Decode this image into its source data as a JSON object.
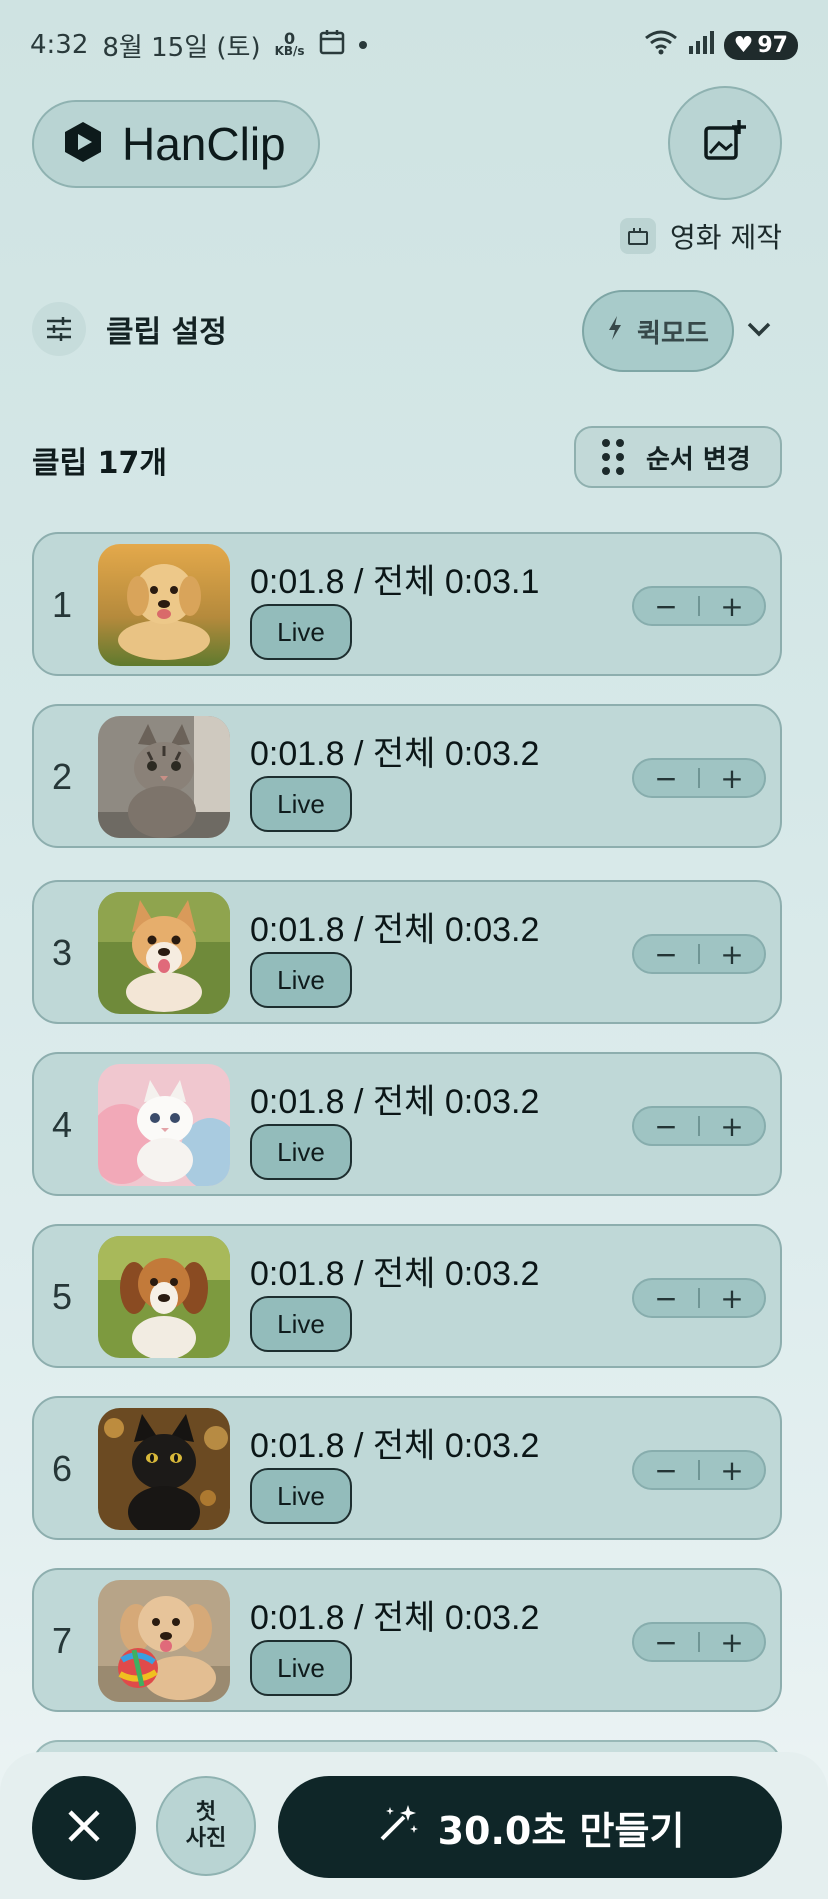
{
  "status_bar": {
    "time": "4:32",
    "date": "8월 15일 (토)",
    "net_speed_value": "0",
    "net_speed_unit": "KB/s",
    "battery": "97"
  },
  "header": {
    "app_name": "HanClip",
    "movie_label": "영화 제작"
  },
  "settings": {
    "clip_settings_label": "클립 설정",
    "quick_mode_label": "퀵모드"
  },
  "list_header": {
    "clip_count": "클립 17개",
    "reorder_label": "순서 변경"
  },
  "clips": [
    {
      "index": "1",
      "time": "0:01.8 / 전체 0:03.1",
      "badge": "Live"
    },
    {
      "index": "2",
      "time": "0:01.8 / 전체 0:03.2",
      "badge": "Live"
    },
    {
      "index": "3",
      "time": "0:01.8 / 전체 0:03.2",
      "badge": "Live"
    },
    {
      "index": "4",
      "time": "0:01.8 / 전체 0:03.2",
      "badge": "Live"
    },
    {
      "index": "5",
      "time": "0:01.8 / 전체 0:03.2",
      "badge": "Live"
    },
    {
      "index": "6",
      "time": "0:01.8 / 전체 0:03.2",
      "badge": "Live"
    },
    {
      "index": "7",
      "time": "0:01.8 / 전체 0:03.2",
      "badge": "Live"
    }
  ],
  "stepper": {
    "minus": "−",
    "plus": "+"
  },
  "bottom": {
    "first_photo_line1": "첫",
    "first_photo_line2": "사진",
    "make_label": "30.0초 만들기"
  },
  "colors": {
    "accent_dark": "#0f2628",
    "card_bg": "#bfd8d7",
    "live_bg": "#93bcbb"
  },
  "icons": [
    "hanclip-logo-icon",
    "add-photo-icon",
    "clapperboard-icon",
    "sliders-icon",
    "bolt-icon",
    "chevron-down-icon",
    "grip-icon",
    "close-icon",
    "magic-wand-icon"
  ]
}
